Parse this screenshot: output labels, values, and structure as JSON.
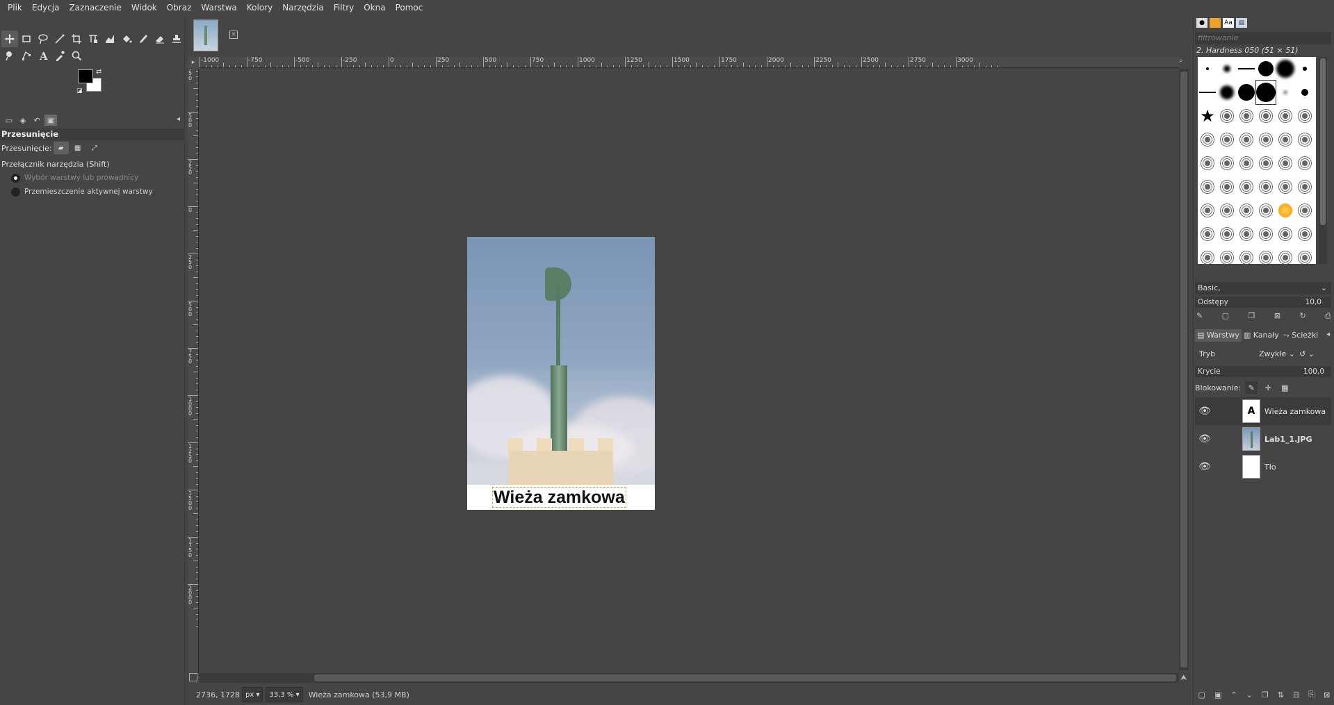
{
  "menubar": {
    "items": [
      "Plik",
      "Edycja",
      "Zaznaczenie",
      "Widok",
      "Obraz",
      "Warstwa",
      "Kolory",
      "Narzędzia",
      "Filtry",
      "Okna",
      "Pomoc"
    ]
  },
  "toolbox": {
    "row1": [
      "move-tool-icon",
      "rect-select-icon",
      "lasso-icon",
      "fuzzy-select-icon",
      "crop-icon",
      "transform-icon",
      "warp-icon",
      "bucket-fill-icon",
      "paintbrush-icon",
      "eraser-icon",
      "clone-icon"
    ],
    "row2": [
      "smudge-icon",
      "paths-icon",
      "text-tool-icon",
      "color-picker-icon",
      "zoom-icon"
    ],
    "fg_color": "#000000",
    "bg_color": "#ffffff"
  },
  "tool_options": {
    "title": "Przesunięcie",
    "move_label": "Przesunięcie:",
    "switch_label": "Przełącznik narzędzia  (Shift)",
    "radio_1": "Wybór warstwy lub prowadnicy",
    "radio_2": "Przemieszczenie aktywnej warstwy"
  },
  "ruler": {
    "h_labels": [
      "-1000",
      "-750",
      "-500",
      "-250",
      "0",
      "250",
      "500",
      "750",
      "1000",
      "1250",
      "1500",
      "1750",
      "2000",
      "2250",
      "2500",
      "2750",
      "3000"
    ],
    "v_labels": [
      "750",
      "500",
      "250",
      "0",
      "250",
      "500",
      "750",
      "1000",
      "1250",
      "1500",
      "1750",
      "2000"
    ]
  },
  "canvas": {
    "caption": "Wieża zamkowa"
  },
  "statusbar": {
    "coords": "2736, 1728",
    "unit": "px",
    "zoom": "33,3 %",
    "message": "Wieża zamkowa (53,9 MB)"
  },
  "brushes": {
    "filter_placeholder": "filtrowanie",
    "current": "2. Hardness 050 (51 × 51)",
    "preset": "Basic,",
    "spacing_label": "Odstępy",
    "spacing_value": "10,0"
  },
  "layers_panel": {
    "tab_layers": "Warstwy",
    "tab_channels": "Kanały",
    "tab_paths": "Ścieżki",
    "mode_label": "Tryb",
    "mode_value": "Zwykłe",
    "opacity_label": "Krycie",
    "opacity_value": "100,0",
    "lock_label": "Blokowanie:",
    "layers": [
      {
        "name": "Wieża zamkowa",
        "type": "text"
      },
      {
        "name": "Lab1_1.JPG",
        "type": "photo"
      },
      {
        "name": "Tło",
        "type": "white"
      }
    ]
  }
}
